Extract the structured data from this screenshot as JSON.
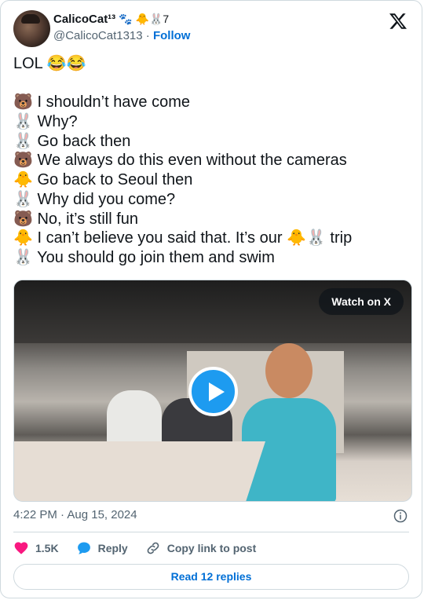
{
  "user": {
    "display_name": "CalicoCat¹³",
    "name_emojis": "🐾 🐥🐰7",
    "handle": "@CalicoCat1313",
    "separator": "·",
    "follow_label": "Follow"
  },
  "icons": {
    "x_logo": "x-logo-icon",
    "info": "info-icon",
    "like": "heart-icon",
    "reply": "reply-icon",
    "copy": "link-icon",
    "play": "play-icon"
  },
  "tweet": {
    "lines": [
      "LOL 😂😂",
      "",
      "🐻 I shouldn’t have come",
      "🐰 Why?",
      "🐰 Go back then",
      "🐻 We always do this even without the cameras",
      "🐥 Go back to Seoul then",
      "🐰 Why did you come?",
      "🐻 No, it’s still fun",
      "🐥 I can’t believe you said that. It’s our 🐥🐰 trip",
      "🐰 You should go join them and swim"
    ]
  },
  "media": {
    "watch_label": "Watch on X"
  },
  "timestamp": "4:22 PM · Aug 15, 2024",
  "actions": {
    "likes_count": "1.5K",
    "reply_label": "Reply",
    "copy_label": "Copy link to post"
  },
  "read_replies_label": "Read 12 replies",
  "colors": {
    "like": "#f91880",
    "accent": "#1d9bf0",
    "link": "#006fd6",
    "muted": "#536471"
  }
}
